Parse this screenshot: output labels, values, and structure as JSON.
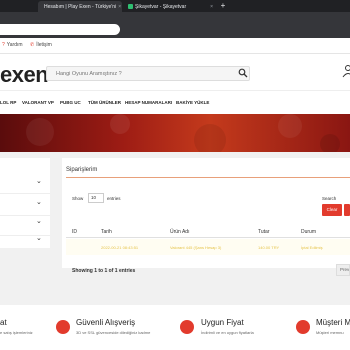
{
  "browser": {
    "tabs": [
      {
        "label": "Hesabım | Play Exen - Türkiye'ni",
        "active": true
      },
      {
        "label": "Şikayetvar - Şikayetvar",
        "active": false
      }
    ],
    "new_tab": "+"
  },
  "topbar": {
    "help": "Yardım",
    "contact": "İletişim"
  },
  "header": {
    "logo": "exen",
    "search_placeholder": "Hangi Oyunu Aramıştınız ?"
  },
  "nav": {
    "items": [
      "LOL RP",
      "VALORANT VP",
      "PUBG UC",
      "TÜM ÜRÜNLER",
      "HESAP NUMARALARI",
      "BAKİYE YÜKLE"
    ]
  },
  "orders": {
    "title": "Siparişlerim",
    "show_label": "Show",
    "show_value": "10",
    "entries_label": "entries",
    "search_label": "Search",
    "clear_label": "Clear",
    "columns": [
      "ID",
      "Tarih",
      "Ürün Adı",
      "Tutar",
      "Durum"
    ],
    "row": [
      "",
      "2022-00-21 08:43:51",
      "Valorant 445 (Şans Hesap 3)",
      "140.00 TRY",
      "İptal Edilmiş"
    ],
    "showing": "Showing 1 to 1 of 1 entries",
    "prev_label": "Previous"
  },
  "features": [
    {
      "title": "at",
      "desc": "e satış işlemleriniz"
    },
    {
      "title": "Güvenli Alışveriş",
      "desc": "3D ve SSL güvenceside dilediğiniz kadme"
    },
    {
      "title": "Uygun Fiyat",
      "desc": "İndirimli ve en uygun fiyatlarla"
    },
    {
      "title": "Müşteri M",
      "desc": "Müşteri memnu"
    }
  ],
  "colors": {
    "accent": "#e23b2d",
    "banner": "#9d1c14"
  }
}
